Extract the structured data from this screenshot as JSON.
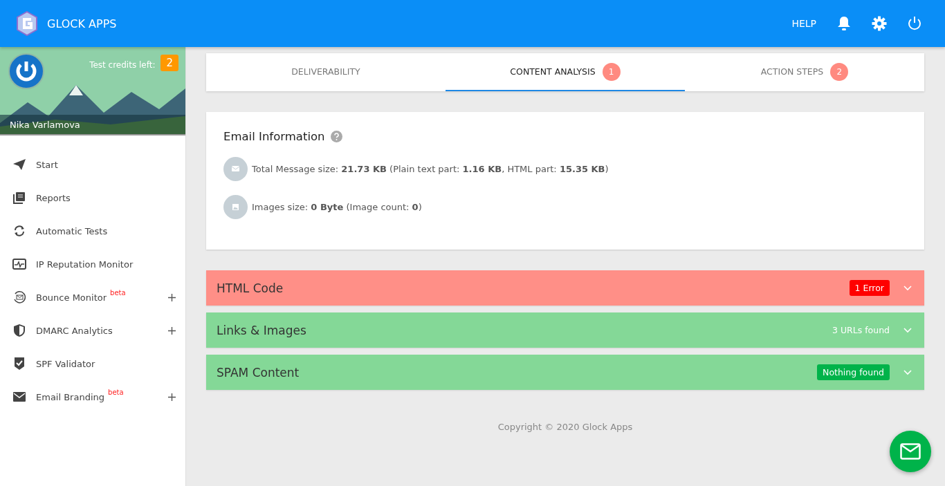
{
  "header": {
    "app_name": "GLOCK APPS",
    "help": "HELP"
  },
  "profile": {
    "credits_label": "Test credits left:",
    "credits": "2",
    "user_name": "Nika Varlamova"
  },
  "sidebar": {
    "items": [
      {
        "label": "Start",
        "expandable": false
      },
      {
        "label": "Reports",
        "expandable": false
      },
      {
        "label": "Automatic Tests",
        "expandable": false
      },
      {
        "label": "IP Reputation Monitor",
        "expandable": false
      },
      {
        "label": "Bounce Monitor",
        "beta": "beta",
        "expandable": true
      },
      {
        "label": "DMARC Analytics",
        "expandable": true
      },
      {
        "label": "SPF Validator",
        "expandable": false
      },
      {
        "label": "Email Branding",
        "beta": "beta",
        "expandable": true
      }
    ]
  },
  "tabs": [
    {
      "label": "DELIVERABILITY",
      "selected": false
    },
    {
      "label": "CONTENT ANALYSIS",
      "count": "1",
      "selected": true
    },
    {
      "label": "ACTION STEPS",
      "count": "2",
      "selected": false
    }
  ],
  "email_information": {
    "title": "Email Information",
    "rows": [
      {
        "text": "Total Message size: **21.73 KB** (Plain text part: **1.16 KB**, HTML part: **15.35 KB**)"
      },
      {
        "text": "Images size: **0 Byte** (Image count: **0**)"
      }
    ]
  },
  "sections": [
    {
      "title": "HTML Code",
      "kind": "error",
      "badge": "1 Error"
    },
    {
      "title": "Links & Images",
      "kind": "info",
      "badge": "3 URLs found"
    },
    {
      "title": "SPAM Content",
      "kind": "clean",
      "badge": "Nothing found"
    }
  ],
  "footer": "Copyright © 2020 Glock Apps"
}
